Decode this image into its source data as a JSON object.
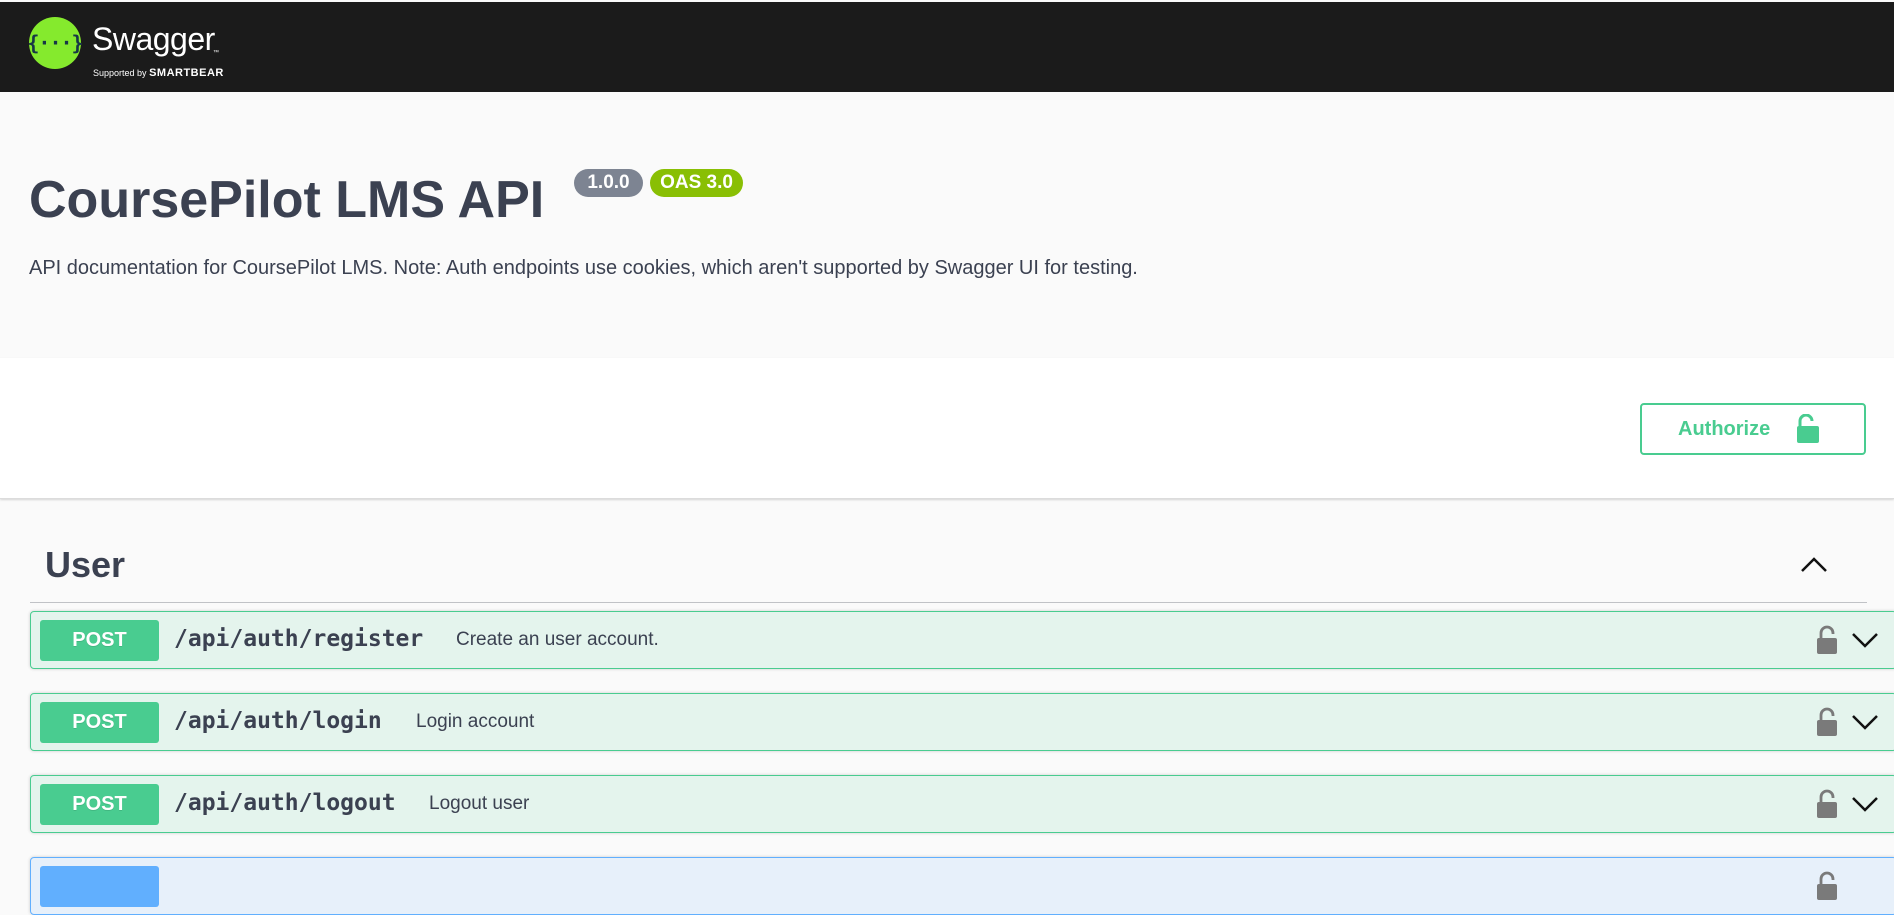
{
  "topbar": {
    "logo_glyph": "{···}",
    "logo_title": "Swagger",
    "logo_tm": "™",
    "logo_supported": "Supported by",
    "logo_brand": "SMARTBEAR"
  },
  "info": {
    "title": "CoursePilot LMS API",
    "version": "1.0.0",
    "oas": "OAS 3.0",
    "description": "API documentation for CoursePilot LMS. Note: Auth endpoints use cookies, which aren't supported by Swagger UI for testing."
  },
  "scheme": {
    "authorize_label": "Authorize"
  },
  "tag": {
    "name": "User",
    "operations": [
      {
        "method": "POST",
        "path": "/api/auth/register",
        "summary": "Create an user account."
      },
      {
        "method": "POST",
        "path": "/api/auth/login",
        "summary": "Login account"
      },
      {
        "method": "POST",
        "path": "/api/auth/logout",
        "summary": "Logout user"
      }
    ]
  },
  "colors": {
    "post": "#49cc90",
    "get": "#61affe",
    "topbar": "#1b1b1b",
    "logo_green": "#85ea2d"
  }
}
